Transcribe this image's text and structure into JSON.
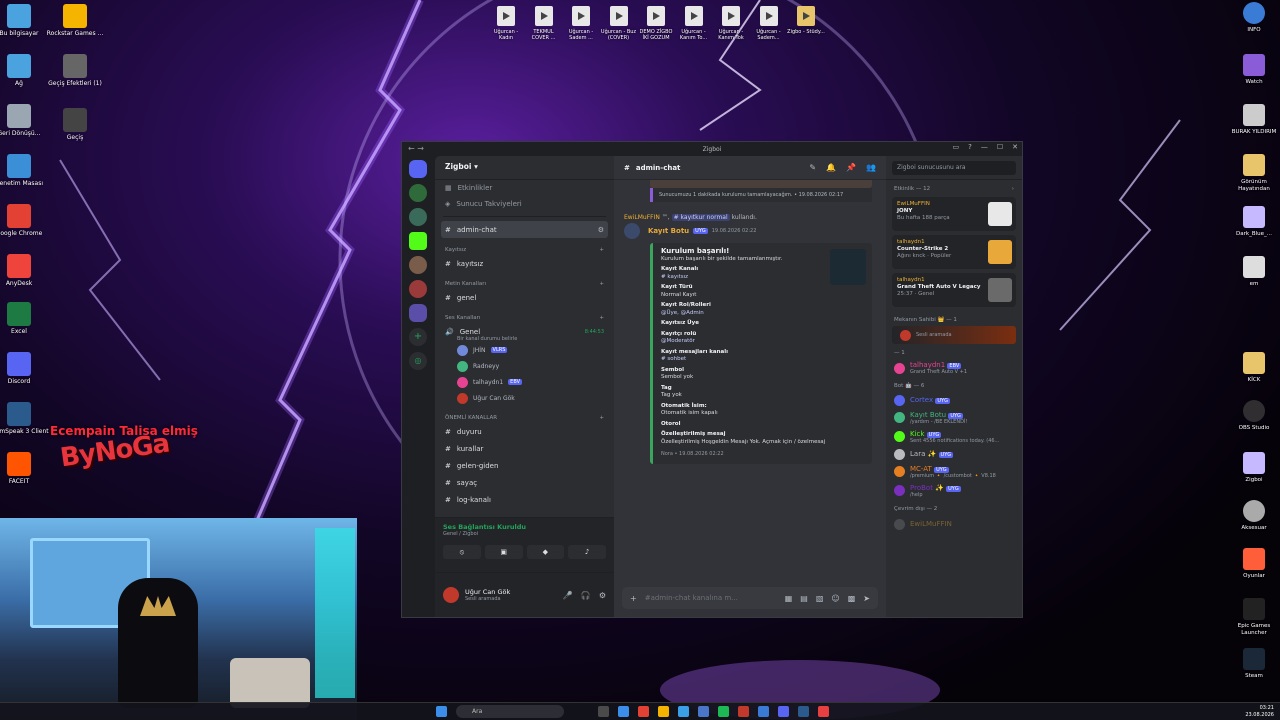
{
  "desktop_left": [
    {
      "label": "Bu bilgisayar",
      "color": "#4aa3df"
    },
    {
      "label": "Rockstar Games ...",
      "color": "#f5b400"
    },
    {
      "label": "Ağ",
      "color": "#4aa3df"
    },
    {
      "label": "Geçiş Efektleri (1)",
      "color": "#666666"
    },
    {
      "label": "Geri Dönüşü...",
      "color": "#9aa6b2"
    },
    {
      "label": "Geçiş",
      "color": "#444444"
    },
    {
      "label": "Denetim Masası",
      "color": "#3a8fd6"
    },
    {
      "label": "Google Chrome",
      "color": "#e34133"
    },
    {
      "label": "AnyDesk",
      "color": "#ef443b"
    },
    {
      "label": "Excel",
      "color": "#1d7a43"
    },
    {
      "label": "Discord",
      "color": "#5865f2"
    },
    {
      "label": "TeamSpeak 3 Client",
      "color": "#2b5a8c"
    },
    {
      "label": "FACEIT",
      "color": "#ff5500"
    }
  ],
  "desktop_top": [
    "Uğurcan - Kadın",
    "TEKMUL COVER ...",
    "Uğurcan - Sadem ...",
    "Uğurcan - Buz (COVER)",
    "DEMO ZİGBO İKİ GOZUM",
    "Uğurcan - Kanım To...",
    "Uğurcan - Kanım Tok",
    "Uğurcan - Sadem...",
    "Zigbo - Stüdy..."
  ],
  "desktop_right": [
    {
      "label": "INFO",
      "color": "#3a7bd5"
    },
    {
      "label": "Watch",
      "color": "#8a5cd8"
    },
    {
      "label": "BURAK YILDIRIM",
      "color": "#cccccc"
    },
    {
      "label": "Görünüm Hayatından",
      "color": "#e8c46a"
    },
    {
      "label": "Dark_Blue_...",
      "color": "#c7b9ff"
    },
    {
      "label": "em",
      "color": "#dddddd"
    },
    {
      "label": "KİCK",
      "color": "#e8c46a"
    },
    {
      "label": "OBS Studio",
      "color": "#302e31"
    },
    {
      "label": "Zigboi",
      "color": "#c7b9ff"
    },
    {
      "label": "Aksesuar",
      "color": "#aaaaaa"
    },
    {
      "label": "Oyunlar",
      "color": "#ff5e3a"
    },
    {
      "label": "Epic Games Launcher",
      "color": "#222222"
    },
    {
      "label": "Steam",
      "color": "#1b2838"
    }
  ],
  "overlay": {
    "line1": "Ecempain Talisa elmiş",
    "logo": "ByNoGa"
  },
  "window": {
    "title": "Zigboi"
  },
  "server": {
    "name": "Zigboi",
    "top_items": [
      "Etkinlikler",
      "Sunucu Takviyeleri"
    ],
    "selected_channel": "admin-chat",
    "categories": [
      {
        "name": "Kayıtsız",
        "channels": [
          "kayıtsız"
        ]
      },
      {
        "name": "Metin Kanalları",
        "channels": [
          "genel"
        ]
      }
    ],
    "voice_category": "Ses Kanalları",
    "voice_channel": "Genel",
    "voice_status": "Bir kanal durumu belirle",
    "voice_time": "8:44:53",
    "voice_users": [
      {
        "name": "JHİN",
        "tag": "VLRS",
        "color": "#7289da"
      },
      {
        "name": "Radneyy",
        "tag": "",
        "color": "#43b581"
      },
      {
        "name": "talhaydn1",
        "tag": "EBV",
        "color": "#e84393"
      },
      {
        "name": "Uğur Can Gök",
        "tag": "",
        "color": "#c0392b"
      }
    ],
    "important_category": "ÖNEMLİ KANALLAR",
    "important_channels": [
      "duyuru",
      "kurallar",
      "gelen-giden",
      "sayaç",
      "log-kanalı"
    ]
  },
  "voice_connected": {
    "status": "Ses Bağlantısı Kuruldu",
    "channel": "Genel / Zigboi"
  },
  "user_panel": {
    "name": "Uğur Can Gök",
    "status": "Sesli aramada"
  },
  "chat": {
    "channel": "admin-chat",
    "prev_footer": "Sunucumuzu 1 dakikada kurulumu tamamlayacağım. • 19.08.2026 02:17",
    "reply_user": "EwiLMuFFIN",
    "reply_tag": "™",
    "reply_cmd": "# kayıtkur normal",
    "reply_suffix": "kullandı.",
    "bot_name": "Kayıt Botu",
    "bot_tag": "UYG",
    "bot_time": "19.08.2026 02:22",
    "embed_title": "Kurulum başarılı!",
    "embed_desc": "Kurulum başarılı bir şekilde tamamlanmıştır.",
    "fields": [
      {
        "k": "Kayıt Kanalı",
        "v": "# kayıtsız"
      },
      {
        "k": "Kayıt Türü",
        "v": "Normal Kayıt"
      },
      {
        "k": "Kayıt Rol/Rolleri",
        "v": "@Üye, @Admin"
      },
      {
        "k": "Kayıtsız Üye",
        "v": ""
      },
      {
        "k": "Kayıtçı rolü",
        "v": "@Moderatör"
      },
      {
        "k": "Kayıt mesajları kanalı",
        "v": "# sohbet"
      },
      {
        "k": "Sembol",
        "v": "Sembol yok"
      },
      {
        "k": "Tag",
        "v": "Tag yok"
      },
      {
        "k": "Otomatik İsim:",
        "v": "Otomatik isim kapalı"
      },
      {
        "k": "Otorol",
        "v": ""
      },
      {
        "k": "Özelleştirilmiş mesaj",
        "v": "Özelleştirilmiş Hoşgeldin Mesajı Yok. Açmak için / özelmesaj"
      }
    ],
    "embed_footer": "Nora • 19.08.2026 02:22",
    "input_placeholder": "#admin-chat kanalına m..."
  },
  "members": {
    "search_placeholder": "Zigboi sunucusunu ara",
    "events_header": "Etkinlik — 12",
    "activities": [
      {
        "user": "EwiLMuFFIN",
        "title": "JONY",
        "sub": "Bu hafta 188 parça",
        "color": "#e8e8e8"
      },
      {
        "user": "talhaydn1",
        "title": "Counter-Strike 2",
        "sub": "Ağını knck · Popüler",
        "color": "#e8a93a"
      },
      {
        "user": "talhaydn1",
        "title": "Grand Theft Auto V Legacy",
        "sub": "25:37 · Genel",
        "color": "#6a6a6a"
      }
    ],
    "owner_header": "Mekanın Sahibi 👑 — 1",
    "owner_status": "Sesli aramada",
    "online_header": "— 1",
    "online_member": {
      "name": "talhaydn1",
      "tag": "EBV",
      "status": "Grand Theft Auto V +1"
    },
    "bot_header": "Bot 🤖 — 6",
    "bots": [
      {
        "name": "Cortex",
        "tag": "UYG",
        "status": "",
        "color": "#5865f2"
      },
      {
        "name": "Kayıt Botu",
        "tag": "UYG",
        "status": "/yardım - /BE EKLENDİ!",
        "color": "#43b581"
      },
      {
        "name": "Kick",
        "tag": "UYG",
        "status": "Sent 4556 notifications today. (46...",
        "color": "#53fc18"
      },
      {
        "name": "Lara ✨",
        "tag": "UYG",
        "status": "",
        "color": "#b9bbbe"
      },
      {
        "name": "MC-AT",
        "tag": "UYG",
        "status": "/premium 🔸 /custombot 🔸 V8.18",
        "color": "#e67e22"
      },
      {
        "name": "ProBot ✨",
        "tag": "UYG",
        "status": "/help",
        "color": "#7b2fbe"
      }
    ],
    "offline_header": "Çevrim dışı — 2",
    "offline_member": "EwiLMuFFIN"
  },
  "taskbar": {
    "search": "Ara",
    "time": "03:21",
    "date": "23.08.2026"
  }
}
